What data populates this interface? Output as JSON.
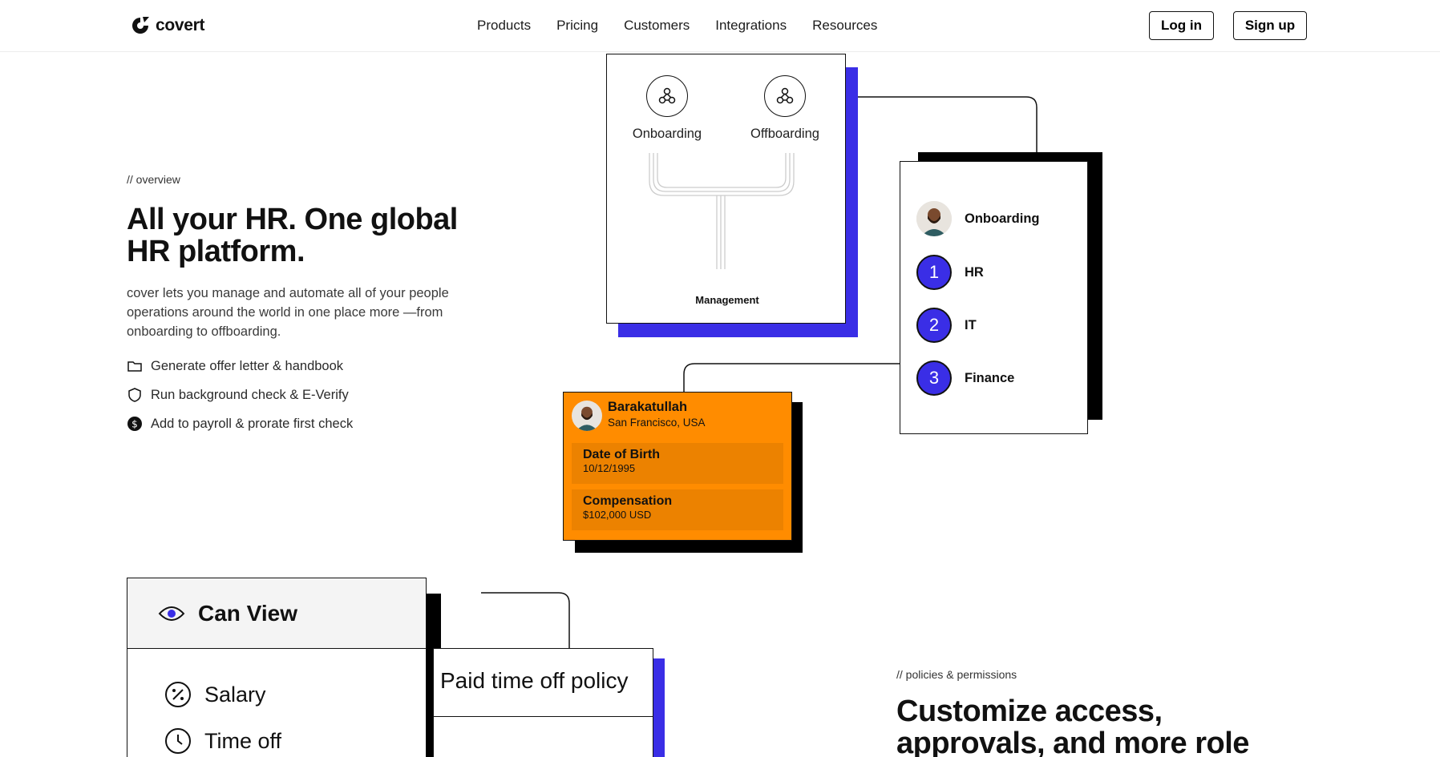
{
  "brand": {
    "name": "covert"
  },
  "nav": {
    "links": [
      "Products",
      "Pricing",
      "Customers",
      "Integrations",
      "Resources"
    ],
    "login": "Log in",
    "signup": "Sign up"
  },
  "hero": {
    "eyebrow": "// overview",
    "title": "All your HR. One global HR platform.",
    "description": "cover lets you manage and automate all of your people operations around the world in one place more —from onboarding to offboarding.",
    "features": [
      {
        "icon": "folder-icon",
        "text": "Generate offer letter & handbook"
      },
      {
        "icon": "shield-icon",
        "text": "Run background check & E-Verify"
      },
      {
        "icon": "dollar-icon",
        "text": "Add to payroll & prorate first check"
      }
    ]
  },
  "workflow": {
    "left": "Onboarding",
    "right": "Offboarding",
    "bottom": "Management"
  },
  "steps": {
    "header": "Onboarding",
    "items": [
      {
        "num": "1",
        "label": "HR"
      },
      {
        "num": "2",
        "label": "IT"
      },
      {
        "num": "3",
        "label": "Finance"
      }
    ]
  },
  "employee": {
    "name": "Barakatullah",
    "location": "San Francisco, USA",
    "dob_label": "Date of Birth",
    "dob_value": "10/12/1995",
    "comp_label": "Compensation",
    "comp_value": "$102,000 USD"
  },
  "permissions": {
    "header": "Can View",
    "items": [
      "Salary",
      "Time off"
    ],
    "policy": "Paid time off policy"
  },
  "section2": {
    "eyebrow": "// policies & permissions",
    "title": "Customize access, approvals, and more role"
  },
  "colors": {
    "accent": "#3a2ee6",
    "orange": "#ff8c00"
  }
}
